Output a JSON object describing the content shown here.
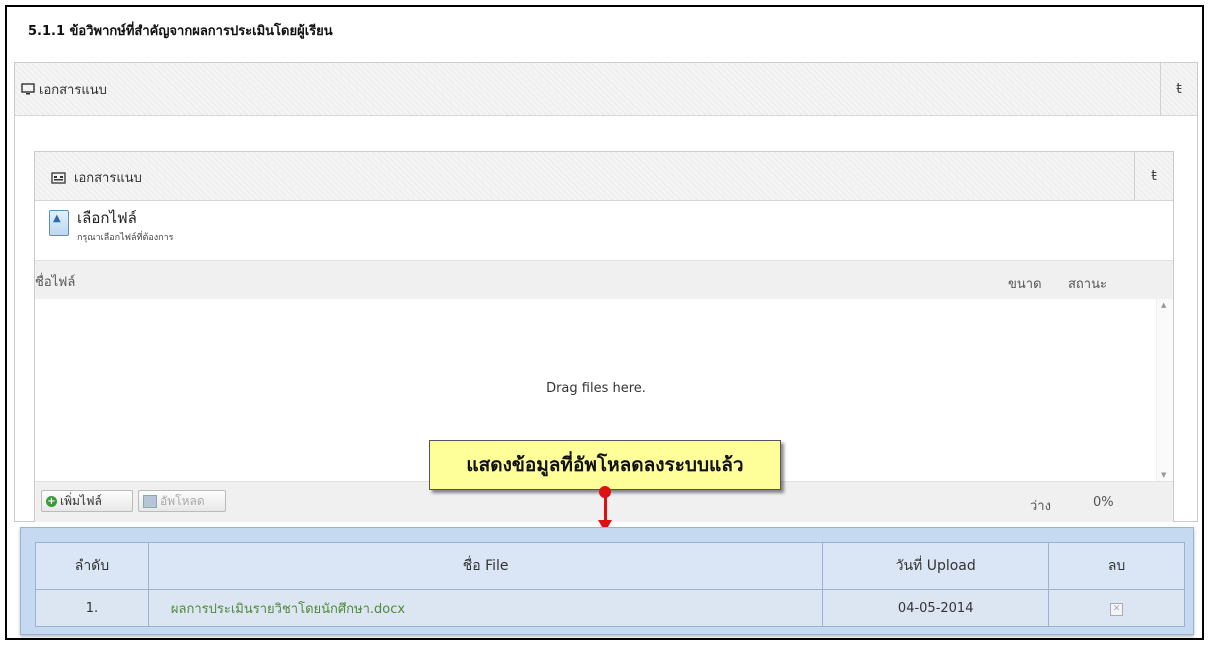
{
  "section_title": "5.1.1 ข้อวิพากษ์ที่สำคัญจากผลการประเมินโดยผู้เรียน",
  "outer_panel": {
    "title": "เอกสารแนบ",
    "icon": "monitor-icon",
    "collapse_symbol": "ŧ"
  },
  "inner_panel": {
    "title": "เอกสารแนบ",
    "icon": "building-icon",
    "collapse_symbol": "ŧ",
    "choose_file_label": "เลือกไฟล์",
    "choose_file_hint": "กรุณาเลือกไฟล์ที่ต้องการ",
    "columns": {
      "name": "ชื่อไฟล์",
      "size": "ขนาด",
      "status": "สถานะ"
    },
    "drop_message": "Drag files here.",
    "add_button": "เพิ่มไฟล์",
    "upload_button": "อัพโหลด",
    "free_label": "ว่าง",
    "percent": "0%"
  },
  "callout": {
    "text": "แสดงข้อมูลที่อัพโหลดลงระบบแล้ว",
    "color": "#ffff99",
    "arrow_color": "#dd1111"
  },
  "result_table": {
    "headers": {
      "order": "ลำดับ",
      "file": "ชื่อ File",
      "date": "วันที่ Upload",
      "delete": "ลบ"
    },
    "rows": [
      {
        "order": "1.",
        "file": "ผลการประเมินรายวิชาโดยนักศึกษา.docx",
        "date": "04-05-2014"
      }
    ]
  }
}
